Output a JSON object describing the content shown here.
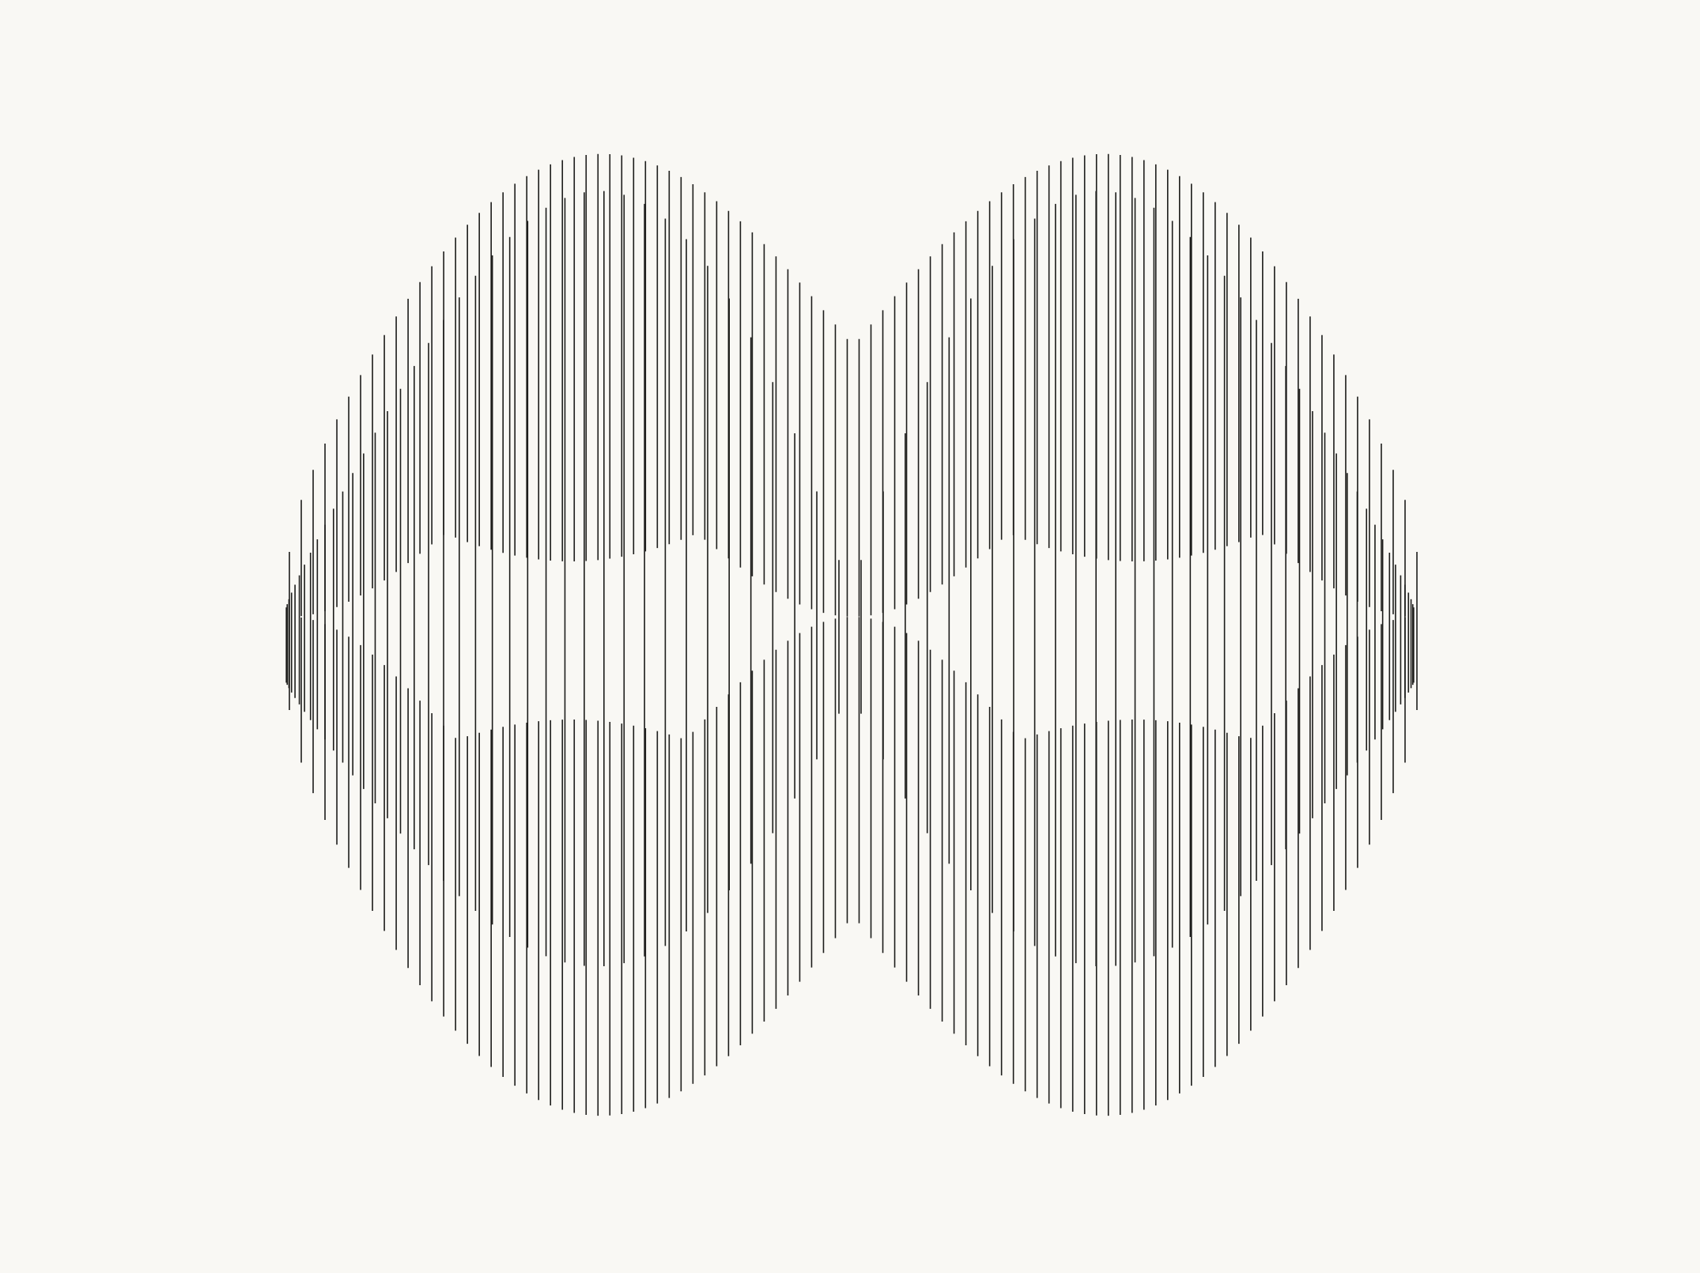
{
  "artwork": {
    "background_color": "#f9f8f4",
    "line_color": "#1c1c1a",
    "description_type": "generative-line-art",
    "families": [
      {
        "name": "cylinder-rings",
        "line_count": 80
      },
      {
        "name": "vertical-wave",
        "line_count": 96
      }
    ]
  }
}
